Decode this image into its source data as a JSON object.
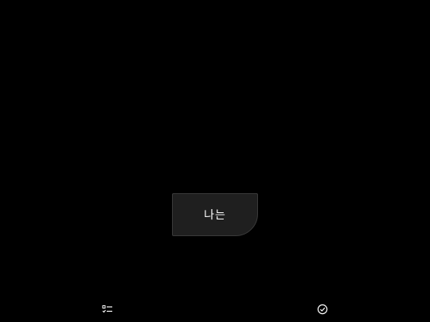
{
  "card": {
    "text": "나는"
  },
  "bottom_bar": {
    "left_icon": "checklist-icon",
    "right_icon": "check-circle-icon"
  },
  "colors": {
    "background": "#000000",
    "card_background": "#1f1f1f",
    "card_border": "#3a3a3a",
    "text": "#ffffff",
    "icon": "#ffffff"
  }
}
